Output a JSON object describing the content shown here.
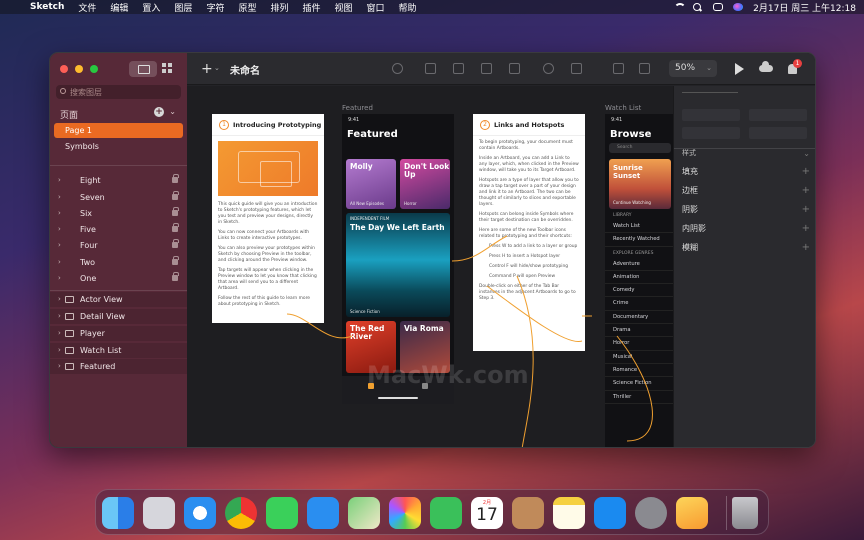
{
  "menubar": {
    "app_name": "Sketch",
    "items": [
      "文件",
      "编辑",
      "置入",
      "图层",
      "字符",
      "原型",
      "排列",
      "插件",
      "视图",
      "窗口",
      "帮助"
    ],
    "datetime": "2月17日 周三 上午12:18",
    "status_icons": [
      "wifi-icon",
      "search-icon",
      "control-center-icon",
      "siri-icon"
    ]
  },
  "window": {
    "document_title": "未命名",
    "zoom": "50%",
    "notification_count": "1"
  },
  "sidebar": {
    "search_placeholder": "搜索图层",
    "pages_header": "页面",
    "pages": [
      {
        "label": "Page 1",
        "active": true
      },
      {
        "label": "Symbols",
        "active": false
      }
    ],
    "layers": [
      {
        "label": "Eight",
        "locked": true
      },
      {
        "label": "Seven",
        "locked": true
      },
      {
        "label": "Six",
        "locked": true
      },
      {
        "label": "Five",
        "locked": true
      },
      {
        "label": "Four",
        "locked": true
      },
      {
        "label": "Two",
        "locked": true
      },
      {
        "label": "One",
        "locked": true
      }
    ],
    "artboards": [
      "Actor View",
      "Detail View",
      "Player",
      "Watch List",
      "Featured"
    ]
  },
  "inspector": {
    "section_style": "样式",
    "rows": [
      "填充",
      "边框",
      "阴影",
      "内阴影",
      "模糊"
    ]
  },
  "canvas": {
    "featured_label": "Featured",
    "watchlist_label": "Watch List",
    "intro": {
      "number": "1",
      "title": "Introducing Prototyping",
      "p1": "This quick guide will give you an introduction to Sketch's prototyping features, which let you test and preview your designs, directly in Sketch.",
      "p2": "You can now connect your Artboards with Links to create interactive prototypes.",
      "p3": "You can also preview your prototypes within Sketch by choosing Preview in the toolbar, and clicking around the Preview window.",
      "p4": "Tap targets will appear when clicking in the Preview window to let you know that clicking that area will send you to a different Artboard.",
      "p5": "Follow the rest of this guide to learn more about prototyping in Sketch."
    },
    "links": {
      "number": "2",
      "title": "Links and Hotspots",
      "p1": "To begin prototyping, your document must contain Artboards.",
      "p2": "Inside an Artboard, you can add a Link to any layer, which, when clicked in the Preview window, will take you to its Target Artboard.",
      "p3": "Hotspots are a type of layer that allow you to draw a tap target over a part of your design and link it to an Artboard. The two can be thought of similarly to slices and exportable layers.",
      "p4": "Hotspots can belong inside Symbols where their target destination can be overridden.",
      "p5": "Here are some of the new Toolbar icons related to prototyping and their shortcuts:",
      "s1": "Press W to add a link to a layer or group",
      "s2": "Press H to insert a Hotspot layer",
      "s3": "Control F will hide/show prototyping",
      "s4": "Command P will open Preview",
      "p6": "Double-click on either of the Tab Bar instances in the adjacent Artboards to go to Step 3."
    },
    "featured": {
      "time": "9:41",
      "title": "Featured",
      "card1_title": "Molly",
      "card1_sub": "All New Episodes",
      "card2_title": "Don't Look Up",
      "card2_sub": "Horror",
      "card3_kicker": "INDEPENDENT FILM",
      "card3_title": "The Day We Left Earth",
      "card3_sub": "Science Fiction",
      "card4_title": "The Red River",
      "card5_title": "Via Roma"
    },
    "browse": {
      "time": "9:41",
      "title": "Browse",
      "search": "Search",
      "hero_title": "Sunrise Sunset",
      "hero_sub": "Continue Watching",
      "library_header": "LIBRARY",
      "library": [
        "Watch List",
        "Recently Watched"
      ],
      "genres_header": "EXPLORE GENRES",
      "genres": [
        "Adventure",
        "Animation",
        "Comedy",
        "Crime",
        "Documentary",
        "Drama",
        "Horror",
        "Musical",
        "Romance",
        "Science Fiction",
        "Thriller"
      ]
    },
    "watermark": "MacWk.com"
  },
  "dock": {
    "apps": [
      "finder-icon",
      "launchpad-icon",
      "safari-icon",
      "chrome-icon",
      "messages-icon",
      "mail-icon",
      "maps-icon",
      "photos-icon",
      "facetime-icon",
      "calendar-icon",
      "contacts-icon",
      "notes-icon",
      "app-store-icon",
      "system-preferences-icon",
      "sketch-icon",
      "trash-icon"
    ],
    "calendar_month": "2月",
    "calendar_day": "17"
  },
  "colors": {
    "accent_orange": "#ea6a22",
    "sidebar_bg": "#5c2a3a",
    "canvas_bg": "#1e1e21"
  }
}
